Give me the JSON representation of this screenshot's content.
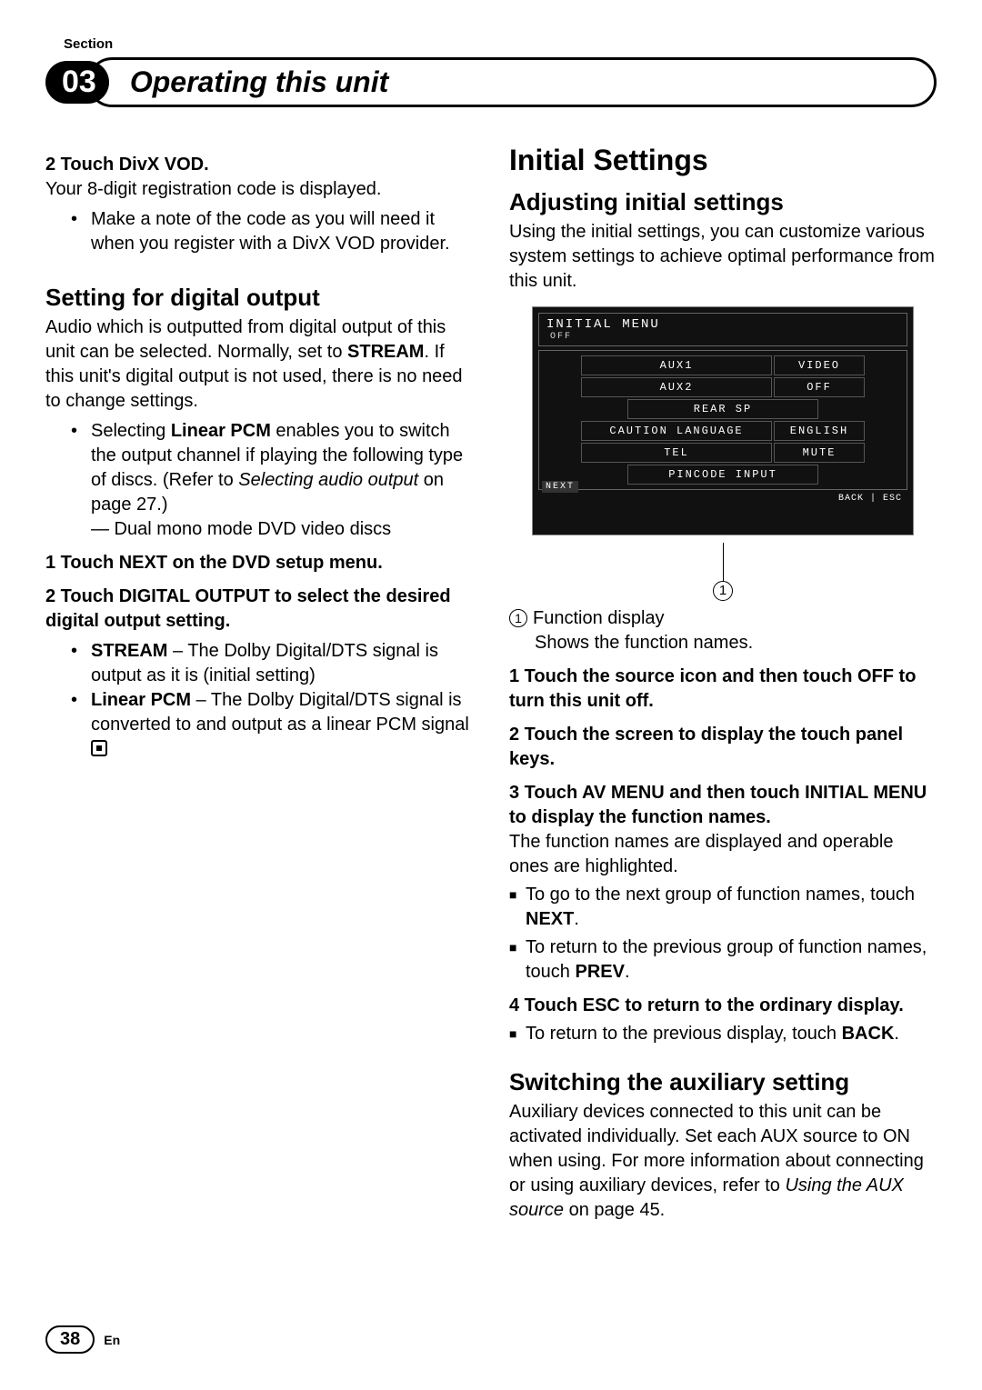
{
  "kicker": "Section",
  "chapter": {
    "num": "03",
    "title": "Operating this unit"
  },
  "left": {
    "step2_lead": "2   Touch DivX VOD.",
    "step2_body": "Your 8-digit registration code is displayed.",
    "step2_bullet": "Make a note of the code as you will need it when you register with a DivX VOD provider.",
    "h3_digital": "Setting for digital output",
    "digital_p1a": "Audio which is outputted from digital output of this unit can be selected. Normally, set to ",
    "digital_p1_strong": "STREAM",
    "digital_p1b": ". If this unit's digital output is not used, there is no need to change settings.",
    "digital_b1a": "Selecting ",
    "digital_b1_strong": "Linear PCM",
    "digital_b1b": " enables you to switch the output channel if playing the following type of discs. (Refer to ",
    "digital_b1_em": "Selecting audio output",
    "digital_b1c": " on page 27.)",
    "digital_dash": "— Dual mono mode DVD video discs",
    "dstep1": "1   Touch NEXT on the DVD setup menu.",
    "dstep2": "2   Touch DIGITAL OUTPUT to select the desired digital output setting.",
    "opt_stream_s": "STREAM",
    "opt_stream_t": " – The Dolby Digital/DTS signal is output as it is (initial setting)",
    "opt_lpcm_s": "Linear PCM",
    "opt_lpcm_t": " – The Dolby Digital/DTS signal is converted to and output as a linear PCM signal"
  },
  "right": {
    "h2": "Initial Settings",
    "h3_adj": "Adjusting initial settings",
    "adj_p": "Using the initial settings, you can customize various system settings to achieve optimal performance from this unit.",
    "osd": {
      "title": "INITIAL MENU",
      "off": "OFF",
      "rows": [
        {
          "l": "AUX1",
          "v": "VIDEO"
        },
        {
          "l": "AUX2",
          "v": "OFF"
        },
        {
          "l": "REAR SP",
          "v": ""
        },
        {
          "l": "CAUTION LANGUAGE",
          "v": "ENGLISH"
        },
        {
          "l": "TEL",
          "v": "MUTE"
        },
        {
          "l": "PINCODE INPUT",
          "v": ""
        }
      ],
      "next": "NEXT",
      "backesc": "BACK | ESC"
    },
    "callout_num": "1",
    "legend_num": "1",
    "legend_a": "Function display",
    "legend_b": "Shows the function names.",
    "rstep1": "1   Touch the source icon and then touch OFF to turn this unit off.",
    "rstep2": "2   Touch the screen to display the touch panel keys.",
    "rstep3": "3   Touch AV MENU and then touch INITIAL MENU to display the function names.",
    "rstep3_p": "The function names are displayed and operable ones are highlighted.",
    "sq1a": "To go to the next group of function names, touch ",
    "sq1b": "NEXT",
    "sq1c": ".",
    "sq2a": "To return to the previous group of function names, touch ",
    "sq2b": "PREV",
    "sq2c": ".",
    "rstep4": "4   Touch ESC to return to the ordinary display.",
    "sq3a": "To return to the previous display, touch ",
    "sq3b": "BACK",
    "sq3c": ".",
    "h3_aux": "Switching the auxiliary setting",
    "aux_p_a": "Auxiliary devices connected to this unit can be activated individually. Set each AUX source to ON when using. For more information about connecting or using auxiliary devices, refer to ",
    "aux_p_em": "Using the AUX source",
    "aux_p_b": " on page 45."
  },
  "footer": {
    "page": "38",
    "lang": "En"
  }
}
